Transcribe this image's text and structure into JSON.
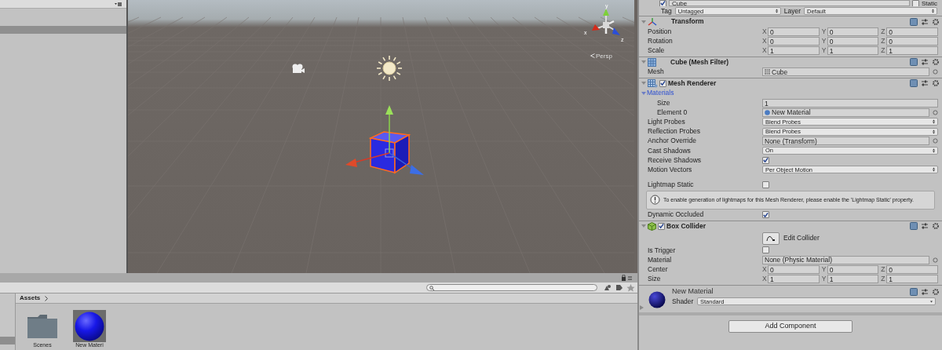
{
  "scene": {
    "view_label": "Persp",
    "gizmo_axes": [
      {
        "label": "y"
      },
      {
        "label": "x"
      },
      {
        "label": "z"
      }
    ]
  },
  "project": {
    "breadcrumb": "Assets",
    "assets": [
      {
        "kind": "folder",
        "name": "Scenes",
        "selected": false
      },
      {
        "kind": "material",
        "name": "New Materi",
        "selected": true
      }
    ]
  },
  "inspector": {
    "object": {
      "name": "Cube",
      "active": true,
      "static_label": "Static",
      "static": false,
      "tag_label": "Tag",
      "tag": "Untagged",
      "layer_label": "Layer",
      "layer": "Default"
    },
    "components": [
      {
        "kind": "transform",
        "title": "Transform",
        "expanded": true,
        "rows": [
          {
            "kind": "vector",
            "label": "Position",
            "values": [
              {
                "axis": "X",
                "value": "0"
              },
              {
                "axis": "Y",
                "value": "0"
              },
              {
                "axis": "Z",
                "value": "0"
              }
            ]
          },
          {
            "kind": "vector",
            "label": "Rotation",
            "values": [
              {
                "axis": "X",
                "value": "0"
              },
              {
                "axis": "Y",
                "value": "0"
              },
              {
                "axis": "Z",
                "value": "0"
              }
            ]
          },
          {
            "kind": "vector",
            "label": "Scale",
            "values": [
              {
                "axis": "X",
                "value": "1"
              },
              {
                "axis": "Y",
                "value": "1"
              },
              {
                "axis": "Z",
                "value": "1"
              }
            ]
          }
        ]
      },
      {
        "kind": "mesh_filter",
        "title": "Cube (Mesh Filter)",
        "expanded": true,
        "rows": [
          {
            "kind": "mesh_object",
            "label": "Mesh",
            "value": "Cube"
          }
        ]
      },
      {
        "kind": "mesh_renderer",
        "title": "Mesh Renderer",
        "enabled": true,
        "expanded": true,
        "rows": [
          {
            "kind": "foldout",
            "label": "Materials",
            "expanded": true,
            "children": [
              {
                "kind": "number",
                "label": "Size",
                "value": "1"
              },
              {
                "kind": "material_object",
                "label": "Element 0",
                "value": "New Material"
              }
            ]
          },
          {
            "kind": "dropdown",
            "label": "Light Probes",
            "value": "Blend Probes"
          },
          {
            "kind": "dropdown",
            "label": "Reflection Probes",
            "value": "Blend Probes"
          },
          {
            "kind": "object",
            "label": "Anchor Override",
            "value": "None (Transform)"
          },
          {
            "kind": "dropdown",
            "label": "Cast Shadows",
            "value": "On"
          },
          {
            "kind": "checkbox",
            "label": "Receive Shadows",
            "checked": true
          },
          {
            "kind": "dropdown",
            "label": "Motion Vectors",
            "value": "Per Object Motion"
          },
          {
            "kind": "section_checkbox",
            "label": "Lightmap Static",
            "checked": false
          },
          {
            "kind": "help",
            "text": "To enable generation of lightmaps for this Mesh Renderer, please enable the 'Lightmap Static' property."
          },
          {
            "kind": "checkbox",
            "label": "Dynamic Occluded",
            "checked": true
          }
        ]
      },
      {
        "kind": "box_collider",
        "title": "Box Collider",
        "enabled": true,
        "expanded": true,
        "rows": [
          {
            "kind": "button",
            "label": "Edit Collider"
          },
          {
            "kind": "checkbox",
            "label": "Is Trigger",
            "checked": false
          },
          {
            "kind": "object",
            "label": "Material",
            "value": "None (Physic Material)"
          },
          {
            "kind": "vector",
            "label": "Center",
            "values": [
              {
                "axis": "X",
                "value": "0"
              },
              {
                "axis": "Y",
                "value": "0"
              },
              {
                "axis": "Z",
                "value": "0"
              }
            ]
          },
          {
            "kind": "vector",
            "label": "Size",
            "values": [
              {
                "axis": "X",
                "value": "1"
              },
              {
                "axis": "Y",
                "value": "1"
              },
              {
                "axis": "Z",
                "value": "1"
              }
            ]
          }
        ]
      },
      {
        "kind": "material",
        "title": "New Material",
        "expanded": false,
        "rows": [
          {
            "kind": "dropdown",
            "label": "Shader",
            "value": "Standard"
          }
        ]
      }
    ],
    "add_component": "Add Component"
  }
}
